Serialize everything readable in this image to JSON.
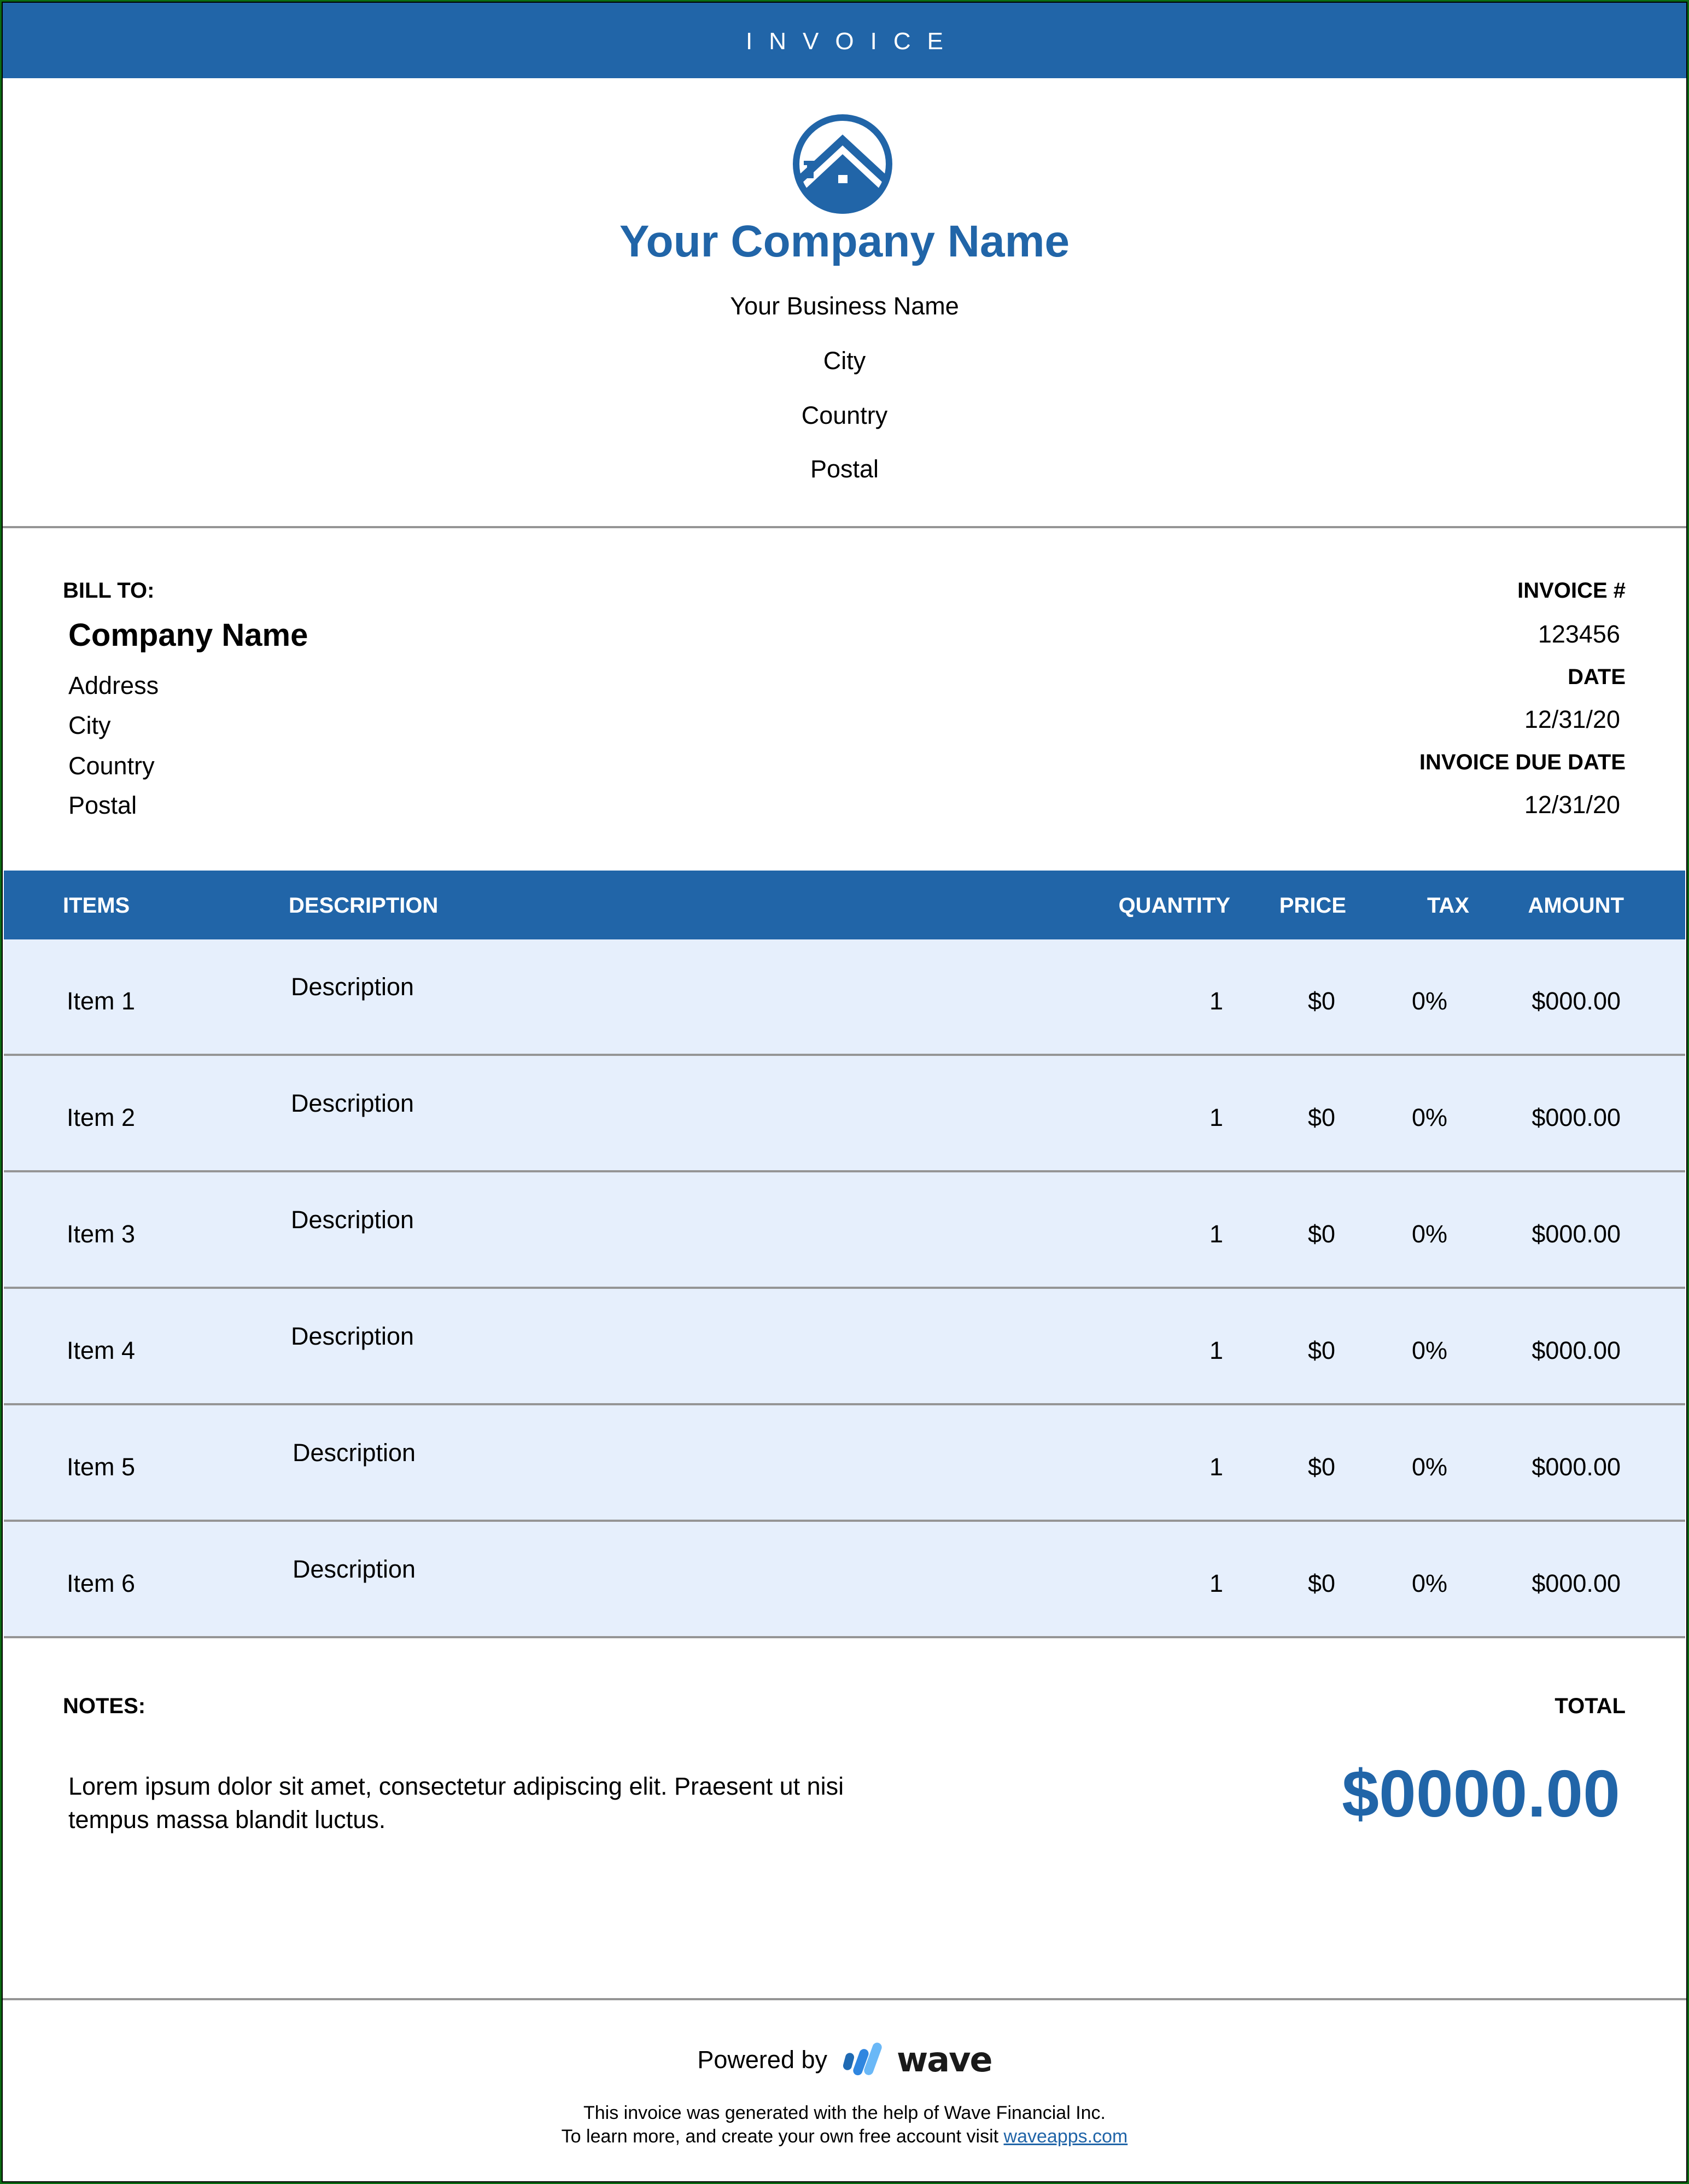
{
  "header": {
    "title": "INVOICE",
    "brand_color": "#2165A8",
    "logo_icon": "house-in-circle-icon"
  },
  "company": {
    "name": "Your Company Name",
    "lines": [
      "Your Business Name",
      "City",
      "Country",
      "Postal"
    ]
  },
  "bill_to": {
    "label": "BILL TO:",
    "name": "Company Name",
    "lines": [
      "Address",
      "City",
      "Country",
      "Postal"
    ]
  },
  "invoice_meta": {
    "number_label": "INVOICE #",
    "number": "123456",
    "date_label": "DATE",
    "date": "12/31/20",
    "due_label": "INVOICE DUE DATE",
    "due_date": "12/31/20"
  },
  "table": {
    "columns": [
      "ITEMS",
      "DESCRIPTION",
      "QUANTITY",
      "PRICE",
      "TAX",
      "AMOUNT"
    ],
    "rows": [
      {
        "item": "Item 1",
        "description": "Description",
        "quantity": "1",
        "price": "$0",
        "tax": "0%",
        "amount": "$000.00"
      },
      {
        "item": "Item 2",
        "description": "Description",
        "quantity": "1",
        "price": "$0",
        "tax": "0%",
        "amount": "$000.00"
      },
      {
        "item": "Item 3",
        "description": "Description",
        "quantity": "1",
        "price": "$0",
        "tax": "0%",
        "amount": "$000.00"
      },
      {
        "item": "Item 4",
        "description": "Description",
        "quantity": "1",
        "price": "$0",
        "tax": "0%",
        "amount": "$000.00"
      },
      {
        "item": "Item 5",
        "description": "Description",
        "quantity": "1",
        "price": "$0",
        "tax": "0%",
        "amount": "$000.00"
      },
      {
        "item": "Item 6",
        "description": "Description",
        "quantity": "1",
        "price": "$0",
        "tax": "0%",
        "amount": "$000.00"
      }
    ]
  },
  "notes": {
    "label": "NOTES:",
    "text": "Lorem ipsum dolor sit amet, consectetur adipiscing elit. Praesent ut nisi tempus massa blandit luctus."
  },
  "total": {
    "label": "TOTAL",
    "amount": "$0000.00"
  },
  "footer": {
    "powered_by": "Powered by",
    "brand_icon": "wave-logo-icon",
    "brand_name": "wave",
    "line1": "This invoice was generated with the help of Wave Financial Inc.",
    "line2_prefix": "To learn more, and create your own free account visit ",
    "link_text": "waveapps.com"
  }
}
